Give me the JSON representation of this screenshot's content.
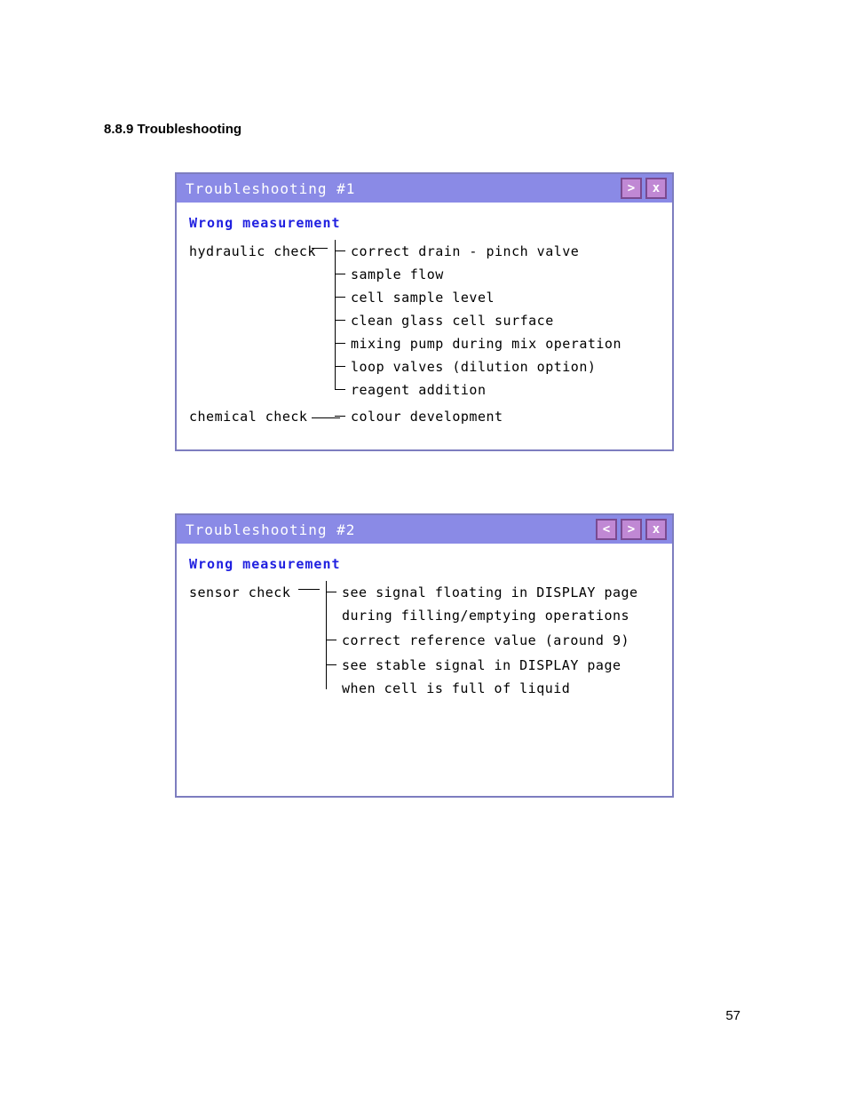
{
  "section_heading": "8.8.9 Troubleshooting",
  "page_number": "57",
  "dialog1": {
    "title": "Troubleshooting #1",
    "buttons": {
      "next": ">",
      "close": "x"
    },
    "subheader": "Wrong measurement",
    "branch1": {
      "label": "hydraulic check",
      "items": [
        "correct drain - pinch valve",
        "sample flow",
        "cell sample level",
        "clean glass cell surface",
        "mixing pump  during mix operation",
        "loop valves (dilution option)",
        "reagent addition"
      ]
    },
    "branch2": {
      "label": "chemical check",
      "items": [
        "colour development"
      ]
    }
  },
  "dialog2": {
    "title": "Troubleshooting #2",
    "buttons": {
      "prev": "<",
      "next": ">",
      "close": "x"
    },
    "subheader": "Wrong measurement",
    "branch1": {
      "label": "sensor check",
      "items": [
        "see signal floating in DISPLAY page during filling/emptying operations",
        "correct reference value (around 9)",
        "see stable signal  in DISPLAY page when cell is full of liquid"
      ]
    }
  }
}
